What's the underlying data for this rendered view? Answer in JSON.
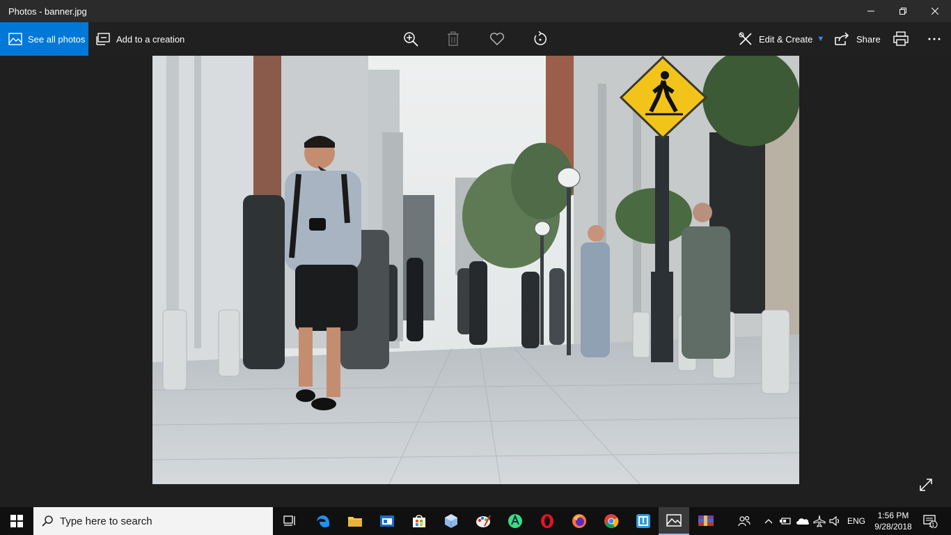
{
  "window": {
    "title": "Photos - banner.jpg"
  },
  "toolbar": {
    "see_all_label": "See all photos",
    "add_to_creation_label": "Add to a creation",
    "edit_create_label": "Edit & Create",
    "share_label": "Share",
    "accent_color": "#0078d7"
  },
  "photo": {
    "file_name": "banner.jpg"
  },
  "taskbar": {
    "search_placeholder": "Type here to search",
    "apps": [
      "task-view",
      "edge",
      "file-explorer",
      "app-window",
      "store",
      "3d-box",
      "paint",
      "android-studio",
      "opera",
      "firefox",
      "chrome",
      "blue-app",
      "photos",
      "winrar"
    ],
    "language": "ENG",
    "time": "1:56 PM",
    "date": "9/28/2018",
    "notification_count": "11"
  }
}
